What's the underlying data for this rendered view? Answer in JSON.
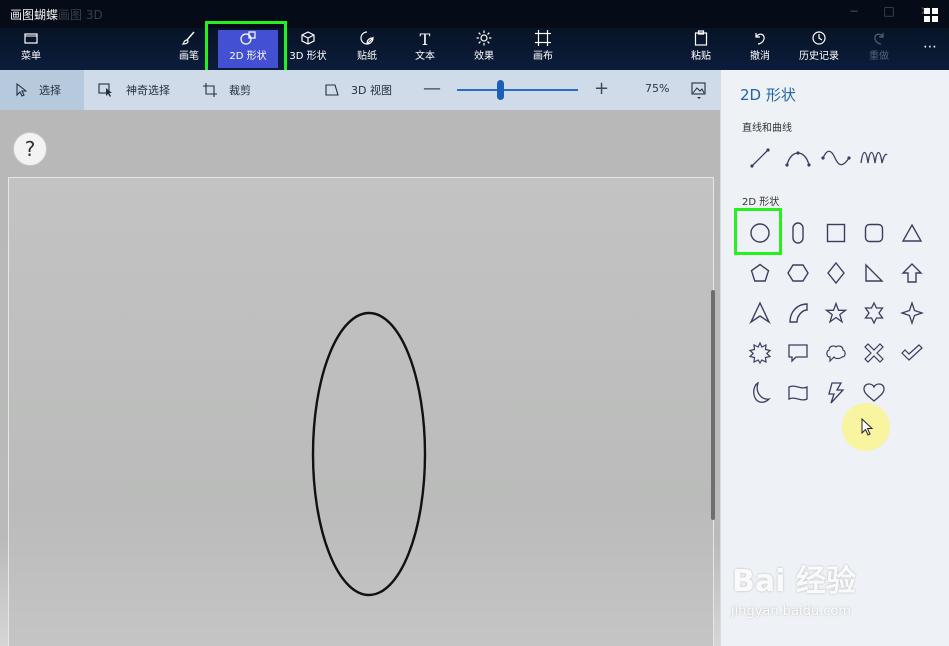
{
  "window": {
    "title": "画图蝴蝶",
    "app_name": "画图 3D",
    "controls": [
      "−",
      "□",
      "✕"
    ]
  },
  "ribbon": {
    "menu": "菜单",
    "tabs": [
      {
        "label": "画笔",
        "icon": "brush-icon"
      },
      {
        "label": "2D 形状",
        "icon": "2d-shapes-icon",
        "active": true
      },
      {
        "label": "3D 形状",
        "icon": "3d-cube-icon"
      },
      {
        "label": "贴纸",
        "icon": "sticker-icon"
      },
      {
        "label": "文本",
        "icon": "text-icon"
      },
      {
        "label": "效果",
        "icon": "sun-icon"
      },
      {
        "label": "画布",
        "icon": "canvas-icon"
      }
    ],
    "paste": "粘贴",
    "undo": "撤消",
    "history": "历史记录",
    "redo": "重做",
    "more": "⋯"
  },
  "toolbar": {
    "select": "选择",
    "magic_select": "神奇选择",
    "crop": "裁剪",
    "view3d": "3D 视图",
    "zoom_value": "75%",
    "zoom_minus": "—",
    "zoom_plus": "+"
  },
  "canvas": {
    "help": "?"
  },
  "panel": {
    "title": "2D 形状",
    "lines_section": "直线和曲线",
    "shapes_section": "2D 形状",
    "lines": [
      "line-icon",
      "curve-icon",
      "wave-icon",
      "zigzag-wave-icon"
    ],
    "shapes": [
      "circle-icon",
      "capsule-icon",
      "square-icon",
      "rounded-square-icon",
      "triangle-icon",
      "pentagon-icon",
      "hexagon-icon",
      "diamond-icon",
      "right-triangle-icon",
      "arrow-up-icon",
      "arrowhead-icon",
      "quarter-circle-icon",
      "star-5-icon",
      "star-6-icon",
      "star-4-icon",
      "burst-icon",
      "speech-bubble-icon",
      "thought-bubble-icon",
      "cross-icon",
      "check-icon",
      "moon-icon",
      "banner-icon",
      "lightning-icon",
      "heart-icon"
    ],
    "selected_shape": "circle-icon"
  },
  "watermark": {
    "brand": "Bai 经验",
    "url": "jingyan.baidu.com"
  },
  "colors": {
    "highlight": "#26f01e",
    "active_tab": "#4350d2",
    "accent": "#1f63b2"
  }
}
